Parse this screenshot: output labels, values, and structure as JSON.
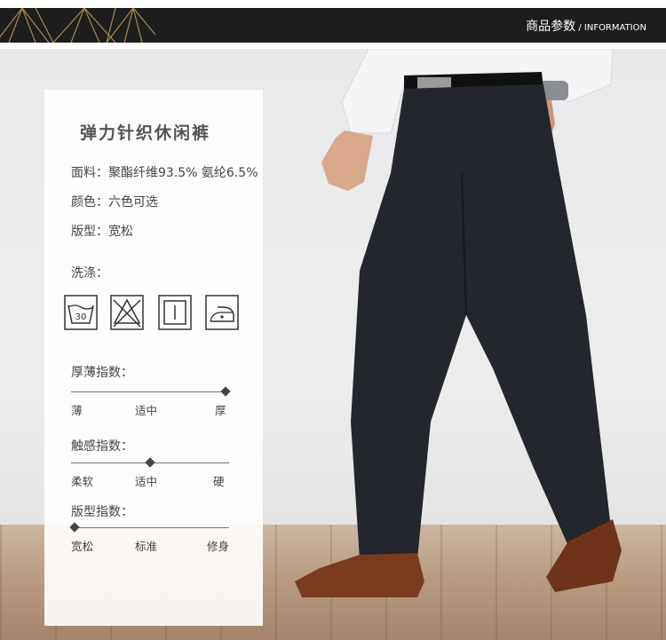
{
  "header": {
    "title_zh": "商品参数",
    "title_en": " / INFORMATION"
  },
  "colors": {
    "header_bg": "#1d1d1d",
    "header_gold": "#a8884e",
    "pants": "#23262d",
    "shoes": "#7a3b1f"
  },
  "product": {
    "name": "弹力针织休闲裤",
    "specs": [
      {
        "key": "面料",
        "value": "聚酯纤维93.5% 氨纶6.5%"
      },
      {
        "key": "颜色",
        "value": "六色可选"
      },
      {
        "key": "版型",
        "value": "宽松"
      }
    ],
    "wash_label": "洗涤：",
    "wash_icons": [
      "wash-30-icon",
      "no-bleach-icon",
      "line-dry-icon",
      "iron-icon"
    ],
    "wash_temp": "30"
  },
  "scales": [
    {
      "label": "厚薄指数：",
      "ticks": [
        "薄",
        "适中",
        "厚"
      ],
      "level": 1.0
    },
    {
      "label": "触感指数：",
      "ticks": [
        "柔软",
        "适中",
        "硬"
      ],
      "level": 0.5
    },
    {
      "label": "版型指数：",
      "ticks": [
        "宽松",
        "标准",
        "修身"
      ],
      "level": 0.0
    }
  ]
}
